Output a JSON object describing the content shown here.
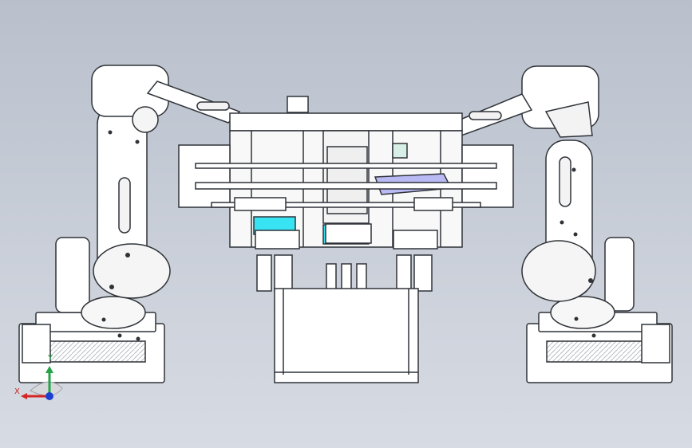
{
  "viewport": {
    "background_top": "#b9c0cc",
    "background_bottom": "#d7dbe3",
    "line_color": "#2f3338",
    "part_fill": "#ffffff",
    "shadow_fill": "#d6d8dc",
    "accent_fill": "#38e3f3",
    "transparent_fill": "#b9b9f3"
  },
  "triad": {
    "x_label": "X",
    "y_label": "Y",
    "x_color": "#d52424",
    "y_color": "#25a347",
    "z_color": "#1d3fd1",
    "icon": "coordinate-triad-icon"
  }
}
